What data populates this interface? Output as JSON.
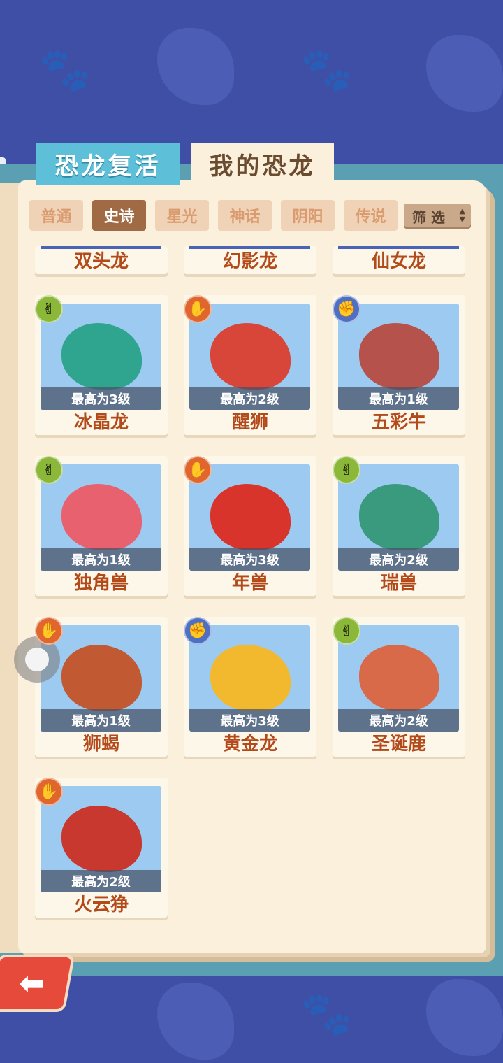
{
  "tabs": {
    "revive": "恐龙复活",
    "mine": "我的恐龙"
  },
  "categories": [
    "普通",
    "史诗",
    "星光",
    "神话",
    "阴阳",
    "传说"
  ],
  "active_category": "史诗",
  "filter": {
    "label": "筛 选",
    "icon": "updown-arrows-icon"
  },
  "partial_row": [
    "双头龙",
    "幻影龙",
    "仙女龙"
  ],
  "cards": [
    {
      "name": "冰晶龙",
      "level": "最高为3级",
      "badge": "scissors",
      "color": "#2fa58f"
    },
    {
      "name": "醒狮",
      "level": "最高为2级",
      "badge": "paper",
      "color": "#d8463a"
    },
    {
      "name": "五彩牛",
      "level": "最高为1级",
      "badge": "rock",
      "color": "#b5524b"
    },
    {
      "name": "独角兽",
      "level": "最高为1级",
      "badge": "scissors",
      "color": "#e8616f"
    },
    {
      "name": "年兽",
      "level": "最高为3级",
      "badge": "paper",
      "color": "#d9342c"
    },
    {
      "name": "瑞兽",
      "level": "最高为2级",
      "badge": "scissors",
      "color": "#3a9a7d"
    },
    {
      "name": "狮蝎",
      "level": "最高为1级",
      "badge": "paper",
      "color": "#c15a32"
    },
    {
      "name": "黄金龙",
      "level": "最高为3级",
      "badge": "rock",
      "color": "#f2b92f"
    },
    {
      "name": "圣诞鹿",
      "level": "最高为2级",
      "badge": "scissors",
      "color": "#d86a4a"
    },
    {
      "name": "火云狰",
      "level": "最高为2级",
      "badge": "paper",
      "color": "#c8382f"
    }
  ],
  "badge_icons": {
    "scissors": "✌",
    "paper": "✋",
    "rock": "✊"
  },
  "back_icon": "back-arrow-icon"
}
